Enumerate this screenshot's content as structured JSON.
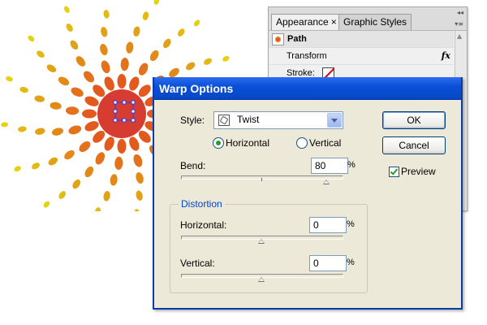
{
  "panel": {
    "tabs": [
      "Appearance",
      "Graphic Styles"
    ],
    "close_glyph": "×",
    "rows": {
      "path": "Path",
      "transform": "Transform",
      "transform_fx": "fx",
      "stroke": "Stroke:"
    }
  },
  "dialog": {
    "title": "Warp Options",
    "style_label": "Style:",
    "style_value": "Twist",
    "orientation": {
      "horizontal": "Horizontal",
      "vertical": "Vertical",
      "selected": "Horizontal"
    },
    "bend": {
      "label": "Bend:",
      "value": "80",
      "unit": "%",
      "level_percent": 80
    },
    "distortion": {
      "title": "Distortion",
      "horizontal": {
        "label": "Horizontal:",
        "value": "0",
        "unit": "%"
      },
      "vertical": {
        "label": "Vertical:",
        "value": "0",
        "unit": "%"
      }
    },
    "buttons": {
      "ok": "OK",
      "cancel": "Cancel"
    },
    "preview": {
      "label": "Preview",
      "checked": true
    }
  },
  "colors": {
    "titlebar": "#0a4fd8",
    "dialog_bg": "#ece9d8",
    "sun_center": "#d93a2a",
    "sun_outer": "#f5d010",
    "distortion_label": "#0046d5"
  }
}
